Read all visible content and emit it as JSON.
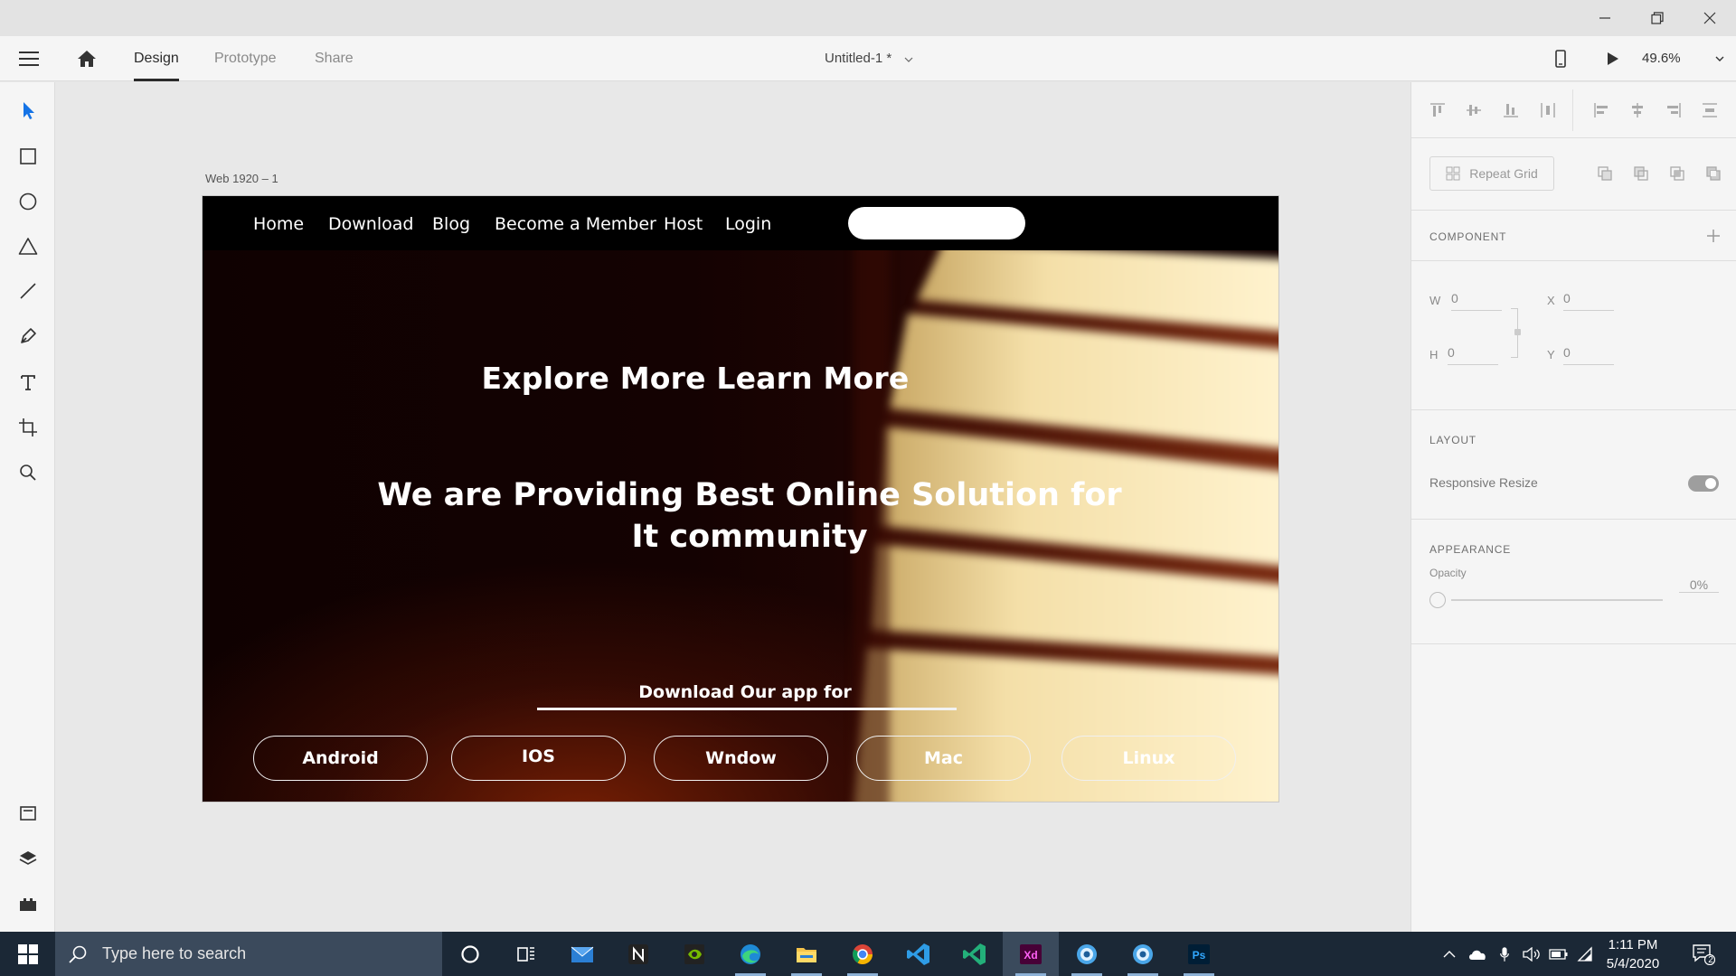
{
  "window": {
    "controls": [
      "minimize-icon",
      "restore-icon",
      "close-icon"
    ]
  },
  "appbar": {
    "tabs": [
      {
        "label": "Design",
        "active": true
      },
      {
        "label": "Prototype",
        "active": false
      },
      {
        "label": "Share",
        "active": false
      }
    ],
    "doc_title": "Untitled-1 *",
    "zoom": "49.6%"
  },
  "toolbar": {
    "tools": [
      "select-icon",
      "rectangle-icon",
      "ellipse-icon",
      "polygon-icon",
      "line-icon",
      "pen-icon",
      "text-icon",
      "artboard-icon",
      "zoom-icon"
    ],
    "bottom": [
      "assets-icon",
      "layers-icon",
      "plugins-icon"
    ]
  },
  "canvas": {
    "artboard_label": "Web 1920 – 1",
    "site": {
      "nav": [
        "Home",
        "Download",
        "Blog",
        "Become a Member",
        "Host",
        "Login"
      ],
      "search_placeholder": "",
      "hero_title": "Explore More Learn More",
      "hero_subtitle_line1": "We are Providing Best Online Solution for",
      "hero_subtitle_line2": "It community",
      "download_label": "Download Our app for",
      "platforms": [
        "Android",
        "IOS",
        "Wndow",
        "Mac",
        "Linux"
      ]
    }
  },
  "panel": {
    "repeat_grid": "Repeat Grid",
    "component_title": "COMPONENT",
    "w_label": "W",
    "w_value": "0",
    "h_label": "H",
    "h_value": "0",
    "x_label": "X",
    "x_value": "0",
    "y_label": "Y",
    "y_value": "0",
    "layout_title": "LAYOUT",
    "responsive_resize": "Responsive Resize",
    "appearance_title": "APPEARANCE",
    "opacity_label": "Opacity",
    "opacity_value": "0%"
  },
  "taskbar": {
    "search_placeholder": "Type here to search",
    "apps": [
      "cortana-icon",
      "task-view-icon",
      "mail-icon",
      "notion-icon",
      "nvidia-icon",
      "edge-icon",
      "file-explorer-icon",
      "chrome-icon",
      "vscode-icon",
      "visual-studio-icon",
      "adobe-xd-icon",
      "browser-icon",
      "browser-icon-2",
      "photoshop-icon"
    ],
    "time": "1:11 PM",
    "date": "5/4/2020",
    "notification_count": "2"
  },
  "colors": {
    "xd_brand": "#ff61f6",
    "photoshop_brand": "#31a8ff",
    "taskbar_bg": "#1b2836"
  }
}
